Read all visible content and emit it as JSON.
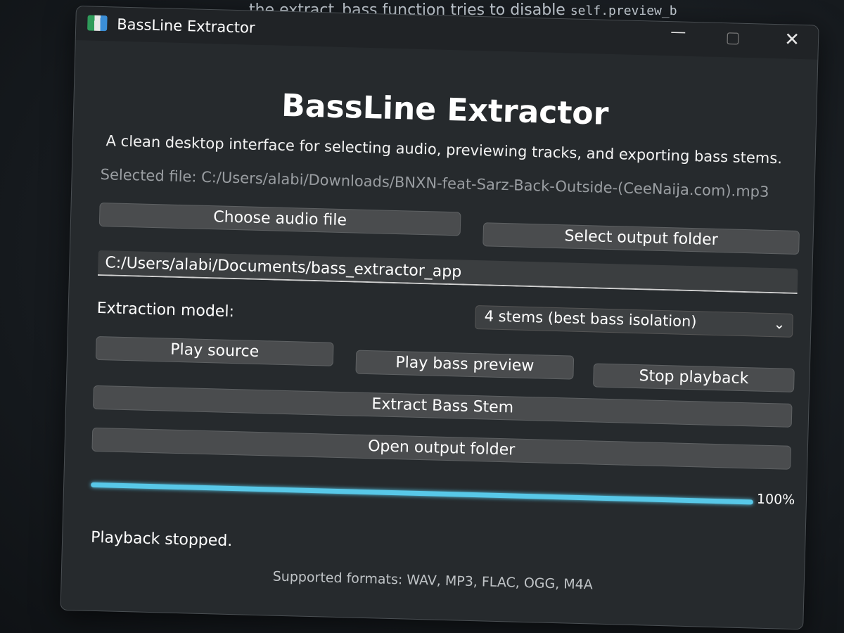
{
  "background": {
    "editor_line": ", the extract_bass function tries to disable",
    "editor_code": "self.preview_b"
  },
  "window": {
    "title": "BassLine Extractor",
    "controls": {
      "minimize": "—",
      "maximize": "▢",
      "close": "✕"
    }
  },
  "header": {
    "title": "BassLine Extractor",
    "subtitle": "A clean desktop interface for selecting audio, previewing tracks, and exporting bass stems."
  },
  "selected_file": "Selected file: C:/Users/alabi/Downloads/BNXN-feat-Sarz-Back-Outside-(CeeNaija.com).mp3",
  "buttons": {
    "choose_audio": "Choose audio file",
    "select_output": "Select output folder",
    "play_source": "Play source",
    "play_bass_preview": "Play bass preview",
    "stop_playback": "Stop playback",
    "extract": "Extract Bass Stem",
    "open_output": "Open output folder"
  },
  "output_path": "C:/Users/alabi/Documents/bass_extractor_app",
  "model": {
    "label": "Extraction model:",
    "selected": "4 stems (best bass isolation)",
    "chevron": "⌄"
  },
  "progress": {
    "value": 100,
    "label": "100%",
    "color": "#58c8e8"
  },
  "status": "Playback stopped.",
  "formats": "Supported formats: WAV, MP3, FLAC, OGG, M4A"
}
